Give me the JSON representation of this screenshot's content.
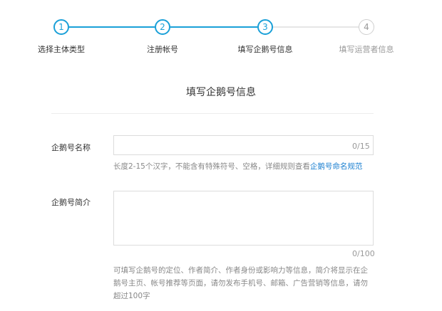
{
  "steps": [
    {
      "number": "1",
      "label": "选择主体类型",
      "state": "done"
    },
    {
      "number": "2",
      "label": "注册帐号",
      "state": "done"
    },
    {
      "number": "3",
      "label": "填写企鹅号信息",
      "state": "current"
    },
    {
      "number": "4",
      "label": "填写运营者信息",
      "state": "pending"
    }
  ],
  "form": {
    "title": "填写企鹅号信息",
    "name_field": {
      "label": "企鹅号名称",
      "value": "",
      "counter": "0/15",
      "hint": "长度2-15个汉字，不能含有特殊符号、空格，详细规则查看",
      "hint_link": "企鹅号命名规范"
    },
    "intro_field": {
      "label": "企鹅号简介",
      "value": "",
      "counter": "0/100",
      "hint_lines": [
        "可填写企鹅号的定位、作者简介、作者身份或影响力等信息，简介将显示在企",
        "鹅号主页、帐号推荐等页面，请勿发布手机号、邮箱、广告营销等信息，请勿",
        "超过100字"
      ]
    }
  },
  "colors": {
    "accent": "#1aa0d8",
    "link": "#1a7fd0",
    "muted": "#999999"
  }
}
